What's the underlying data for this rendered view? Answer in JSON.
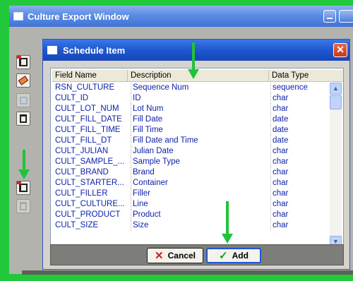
{
  "outer_window": {
    "title": "Culture Export Window"
  },
  "dialog": {
    "title": "Schedule Item",
    "close_glyph": "✕",
    "columns": [
      "Field Name",
      "Description",
      "Data Type"
    ],
    "rows": [
      [
        "RSN_CULTURE",
        "Sequence Num",
        "sequence"
      ],
      [
        "CULT_ID",
        "ID",
        "char"
      ],
      [
        "CULT_LOT_NUM",
        "Lot Num",
        "char"
      ],
      [
        "CULT_FILL_DATE",
        "Fill Date",
        "date"
      ],
      [
        "CULT_FILL_TIME",
        "Fill Time",
        "date"
      ],
      [
        "CULT_FILL_DT",
        "Fill Date and Time",
        "date"
      ],
      [
        "CULT_JULIAN",
        "Julian Date",
        "char"
      ],
      [
        "CULT_SAMPLE_...",
        "Sample Type",
        "char"
      ],
      [
        "CULT_BRAND",
        "Brand",
        "char"
      ],
      [
        "CULT_STARTER...",
        "Container",
        "char"
      ],
      [
        "CULT_FILLER",
        "Filler",
        "char"
      ],
      [
        "CULT_CULTURE...",
        "Line",
        "char"
      ],
      [
        "CULT_PRODUCT",
        "Product",
        "char"
      ],
      [
        "CULT_SIZE",
        "Size",
        "char"
      ]
    ],
    "scroll_up": "▲",
    "scroll_down": "▼",
    "scroll_left": "◀",
    "scroll_right": "▶",
    "cancel_label": "Cancel",
    "cancel_glyph": "✕",
    "add_label": "Add",
    "add_glyph": "✓"
  },
  "toolbar": {
    "icons": [
      "add-item-icon",
      "edit-icon",
      "copy-icon",
      "delete-icon",
      "add-item-icon",
      "delete-icon"
    ]
  },
  "colors": {
    "background_green": "#21c93a",
    "title_blue": "#1e57d0",
    "row_text": "#0a1fa8"
  }
}
